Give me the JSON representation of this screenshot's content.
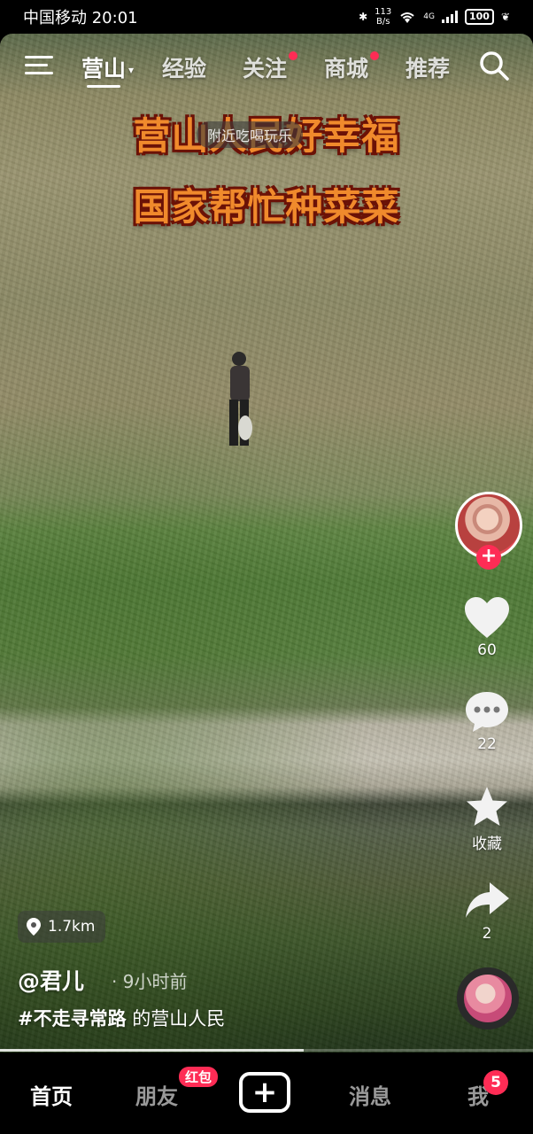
{
  "status_bar": {
    "carrier": "中国移动",
    "time": "20:01",
    "net_speed_value": "113",
    "net_speed_unit": "B/s",
    "network": "4G",
    "battery": "100"
  },
  "top_nav": {
    "tabs": [
      {
        "label": "营山",
        "active": true
      },
      {
        "label": "经验"
      },
      {
        "label": "关注"
      },
      {
        "label": "商城"
      },
      {
        "label": "推荐"
      }
    ]
  },
  "overlay": {
    "caption_line1": "营山人民好幸福",
    "caption_line2": "国家帮忙种菜菜",
    "nearby_pill": "附近吃喝玩乐"
  },
  "actions": {
    "likes": "60",
    "comments": "22",
    "favorite_label": "收藏",
    "shares": "2"
  },
  "video_info": {
    "distance": "1.7km",
    "author": "@君儿",
    "posted_time": "· 9小时前",
    "hashtag": "#不走寻常路",
    "description": "的营山人民",
    "progress": 0.57
  },
  "bottom_nav": {
    "home": "首页",
    "friends": "朋友",
    "friends_badge": "红包",
    "add": "+",
    "messages": "消息",
    "me": "我",
    "me_badge": "5"
  },
  "colors": {
    "accent": "#fe2c55",
    "caption_fill": "#f08a2c",
    "caption_stroke": "#6b1207"
  }
}
